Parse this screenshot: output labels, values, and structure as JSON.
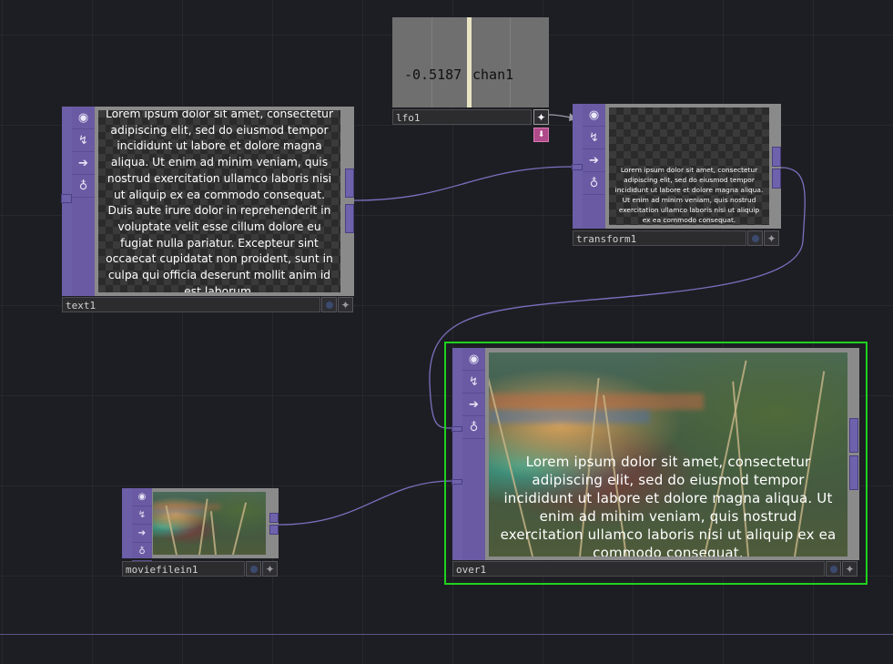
{
  "colors": {
    "background": "#1d1e23",
    "node_purple": "#6c5ea7",
    "wire": "#7b70c0",
    "selection": "#1fd11f"
  },
  "icons": [
    "viewer-toggle-icon",
    "cook-icon",
    "bypass-icon",
    "lock-icon",
    "plus-icon",
    "viewer-dot-icon",
    "output-marker-icon"
  ],
  "lfo": {
    "name": "lfo1",
    "value": "-0.5187",
    "channel": "chan1"
  },
  "text_node": {
    "name": "text1",
    "content": "Lorem ipsum dolor sit amet, consectetur adipiscing elit, sed do eiusmod tempor incididunt ut labore et dolore magna aliqua. Ut enim ad minim veniam, quis nostrud exercitation ullamco laboris nisi ut aliquip ex ea commodo consequat. Duis aute irure dolor in reprehenderit in voluptate velit esse cillum dolore eu fugiat nulla pariatur. Excepteur sint occaecat cupidatat non proident, sunt in culpa qui officia deserunt mollit anim id est laborum."
  },
  "transform_node": {
    "name": "transform1",
    "content": "Lorem ipsum dolor sit amet, consectetur adipiscing elit, sed do eiusmod tempor incididunt ut labore et dolore magna aliqua. Ut enim ad minim veniam, quis nostrud exercitation ullamco laboris nisi ut aliquip ex ea commodo consequat."
  },
  "moviefile_node": {
    "name": "moviefilein1"
  },
  "over_node": {
    "name": "over1",
    "content": "Lorem ipsum dolor sit amet, consectetur adipiscing elit, sed do eiusmod tempor incididunt ut labore et dolore magna aliqua. Ut enim ad minim veniam, quis nostrud exercitation ullamco laboris nisi ut aliquip ex ea commodo consequat.",
    "selected": true
  }
}
